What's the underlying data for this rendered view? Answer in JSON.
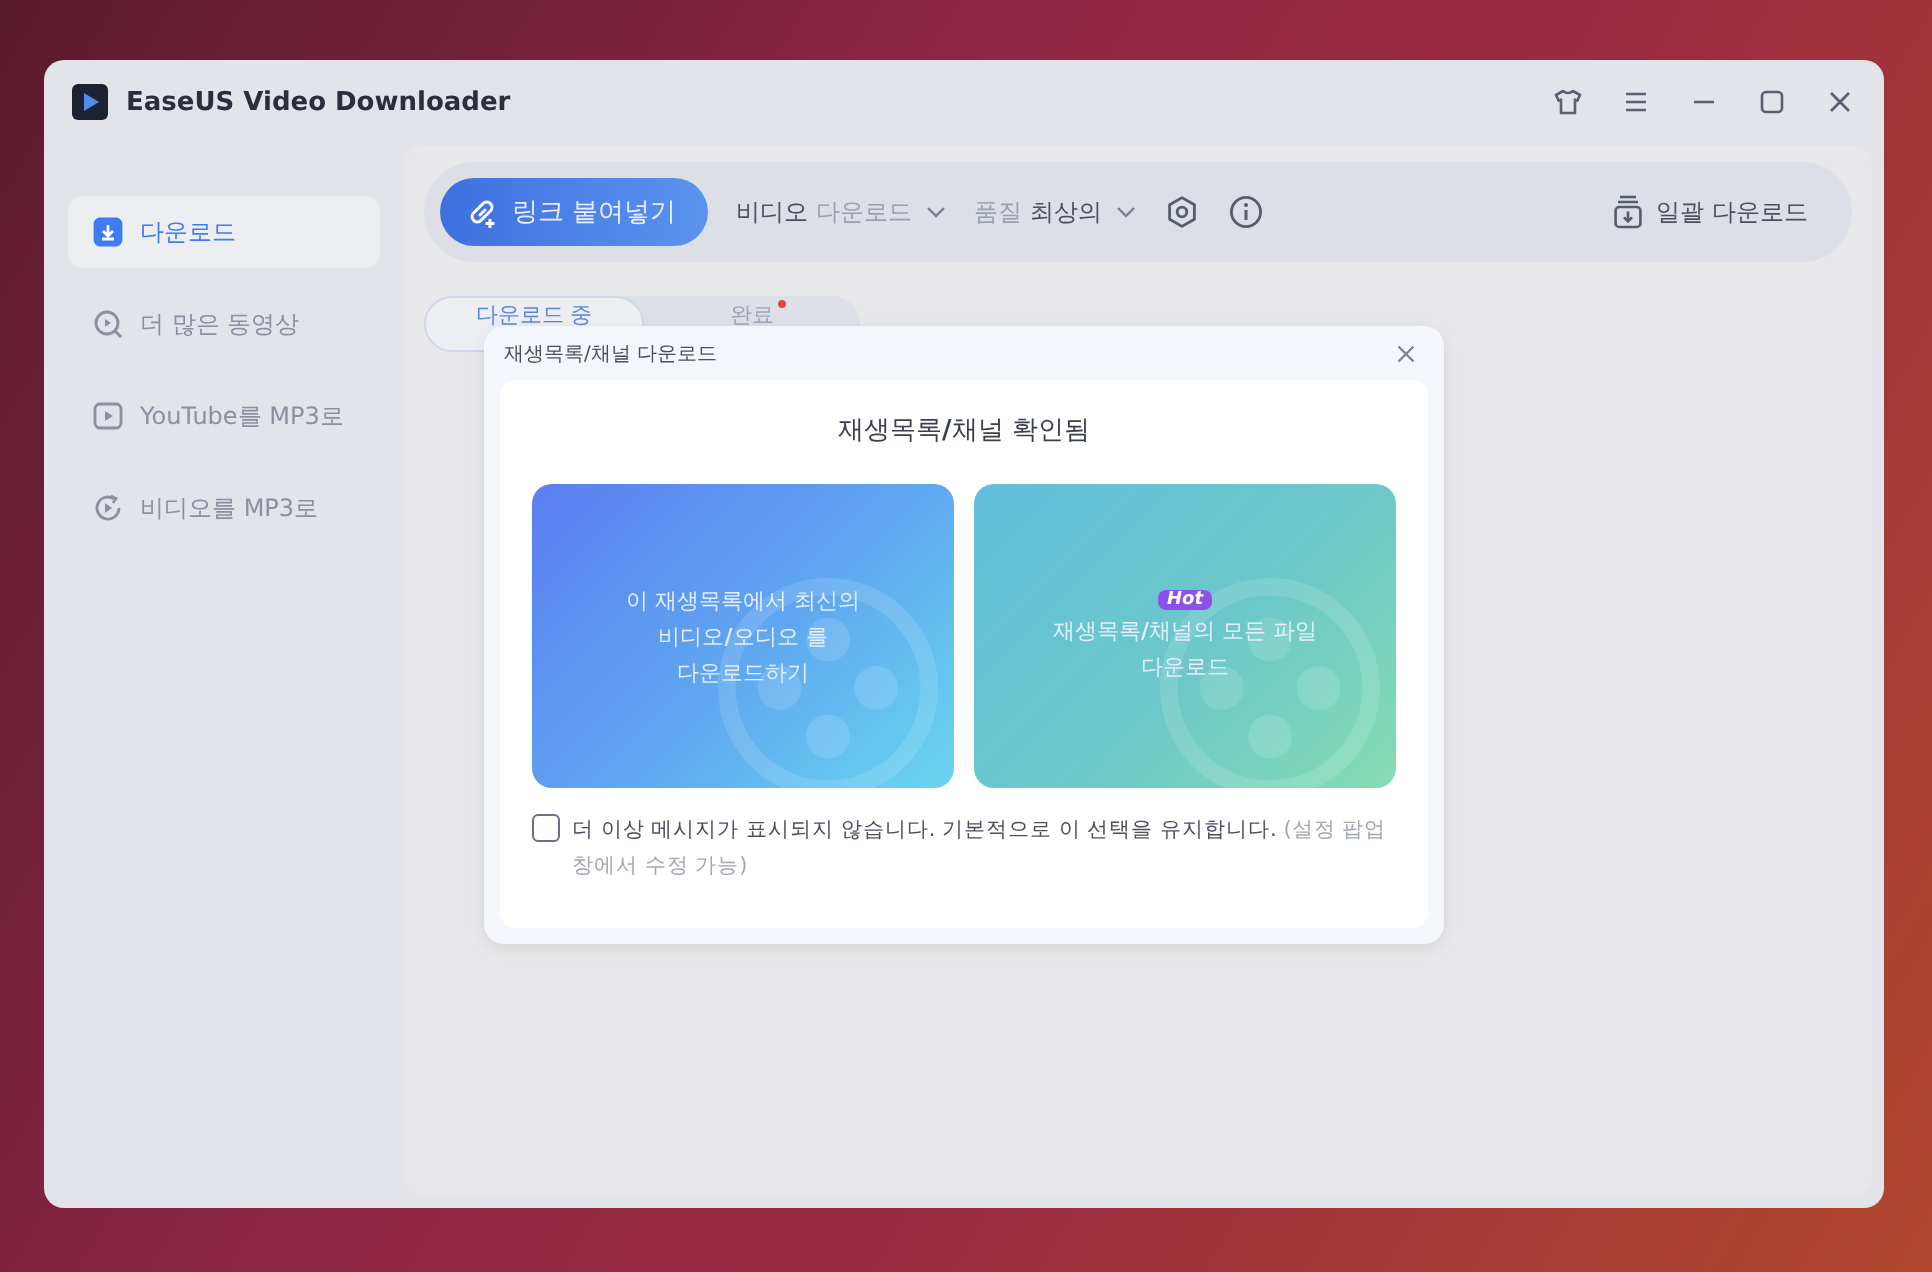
{
  "window": {
    "title": "EaseUS Video Downloader"
  },
  "sidebar": {
    "items": [
      {
        "label": "다운로드",
        "selected": true,
        "kind": "download"
      },
      {
        "label": "더 많은 동영상",
        "selected": false,
        "kind": "search"
      },
      {
        "label": "YouTube를 MP3로",
        "selected": false,
        "kind": "play"
      },
      {
        "label": "비디오를 MP3로",
        "selected": false,
        "kind": "convert"
      }
    ]
  },
  "toolbar": {
    "paste_button": "링크 붙여넣기",
    "mode": {
      "label": "비디오",
      "value": "다운로드"
    },
    "quality": {
      "label": "품질",
      "value": "최상의"
    },
    "batch_button": "일괄 다운로드"
  },
  "tabs": [
    {
      "label": "다운로드 중",
      "selected": true,
      "badge": false
    },
    {
      "label": "완료",
      "selected": false,
      "badge": true
    }
  ],
  "dialog": {
    "title": "재생목록/채널 다운로드",
    "heading": "재생목록**/**채널 확인됨",
    "options": [
      {
        "lines": [
          "이 재생목록에서 최신의",
          "비디오**/**오디오 를",
          "다운로드하기"
        ],
        "hot": false,
        "kind": "latest"
      },
      {
        "tag": "Hot",
        "lines": [
          "재생목록**/**채널의 모든 파일",
          "다운로드"
        ],
        "hot": true,
        "kind": "all"
      }
    ],
    "checkbox": {
      "checked": false,
      "label": "더 이상 메시지가 표시되지 않습니다. 기본적으로 이 선택을 유지합니다.",
      "note": "(설정 팝업 창에서 수정 가능)"
    }
  }
}
